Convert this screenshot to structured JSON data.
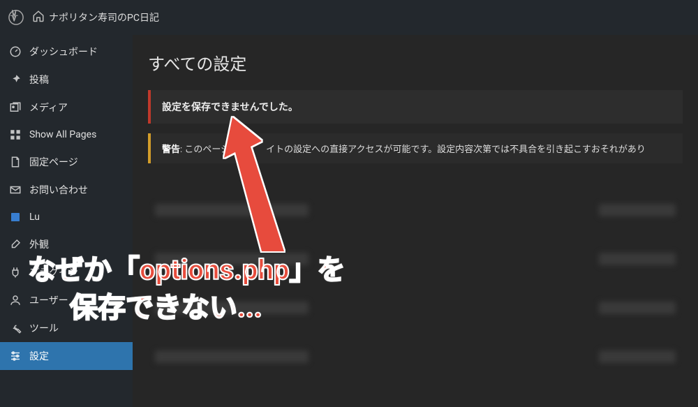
{
  "admin_bar": {
    "site_title": "ナポリタン寿司のPC日記"
  },
  "sidebar": {
    "items": [
      {
        "icon": "dashboard",
        "label": "ダッシュボード"
      },
      {
        "icon": "pin",
        "label": "投稿"
      },
      {
        "icon": "media",
        "label": "メディア"
      },
      {
        "icon": "pages-all",
        "label": "Show All Pages"
      },
      {
        "icon": "page",
        "label": "固定ページ"
      },
      {
        "icon": "mail",
        "label": "お問い合わせ"
      },
      {
        "icon": "lux",
        "label": "Lu"
      },
      {
        "icon": "brush",
        "label": "外観"
      },
      {
        "icon": "plugin",
        "label": "プラグイン"
      },
      {
        "icon": "user",
        "label": "ユーザー"
      },
      {
        "icon": "tool",
        "label": "ツール"
      },
      {
        "icon": "settings",
        "label": "設定",
        "active": true
      }
    ]
  },
  "main": {
    "title": "すべての設定",
    "error_notice": "設定を保存できませんでした。",
    "warning": {
      "prefix": "警告",
      "body": ": このページは　　　イトの設定への直接アクセスが可能です。設定内容次第では不具合を引き起こすおそれがあり"
    }
  },
  "annotation": {
    "line1": "なぜか「options.php」を",
    "line2": "保存できない..."
  }
}
